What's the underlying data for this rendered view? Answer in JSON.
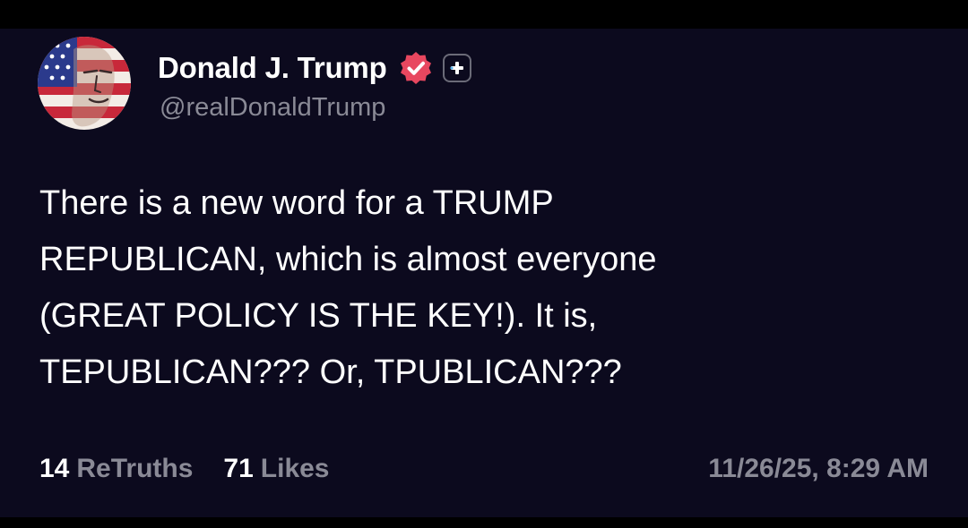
{
  "author": {
    "display_name": "Donald J. Trump",
    "handle": "@realDonaldTrump",
    "avatar_icon": "flag-portrait-avatar",
    "verified_icon": "verified-badge-icon",
    "plus_icon": "plus-icon"
  },
  "post": {
    "lines": [
      "There is a new word for a TRUMP",
      "REPUBLICAN, which is almost everyone",
      "(GREAT POLICY IS THE KEY!). It is,",
      "TEPUBLICAN??? Or, TPUBLICAN???"
    ]
  },
  "stats": {
    "retruths_count": "14",
    "retruths_label": "ReTruths",
    "likes_count": "71",
    "likes_label": "Likes"
  },
  "timestamp": "11/26/25, 8:29 AM",
  "colors": {
    "background": "#0c0a1e",
    "text": "#ffffff",
    "muted": "#8a8a96",
    "verified": "#e8475f"
  }
}
